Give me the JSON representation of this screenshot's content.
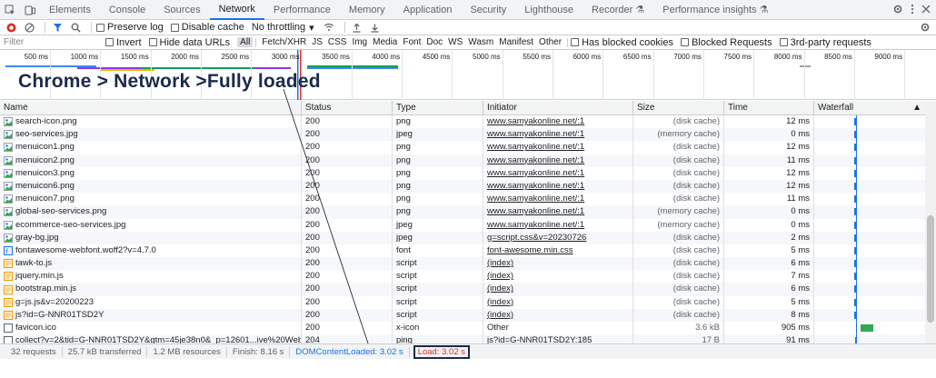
{
  "tabs": [
    {
      "label": "Elements",
      "active": false
    },
    {
      "label": "Console",
      "active": false
    },
    {
      "label": "Sources",
      "active": false
    },
    {
      "label": "Network",
      "active": true
    },
    {
      "label": "Performance",
      "active": false
    },
    {
      "label": "Memory",
      "active": false
    },
    {
      "label": "Application",
      "active": false
    },
    {
      "label": "Security",
      "active": false
    },
    {
      "label": "Lighthouse",
      "active": false
    },
    {
      "label": "Recorder",
      "active": false
    },
    {
      "label": "Performance insights",
      "active": false
    }
  ],
  "toolbar": {
    "preserve_log": "Preserve log",
    "disable_cache": "Disable cache",
    "throttle": "No throttling"
  },
  "filterbar": {
    "placeholder": "Filter",
    "invert": "Invert",
    "hide_data_urls": "Hide data URLs",
    "types": [
      "All",
      "Fetch/XHR",
      "JS",
      "CSS",
      "Img",
      "Media",
      "Font",
      "Doc",
      "WS",
      "Wasm",
      "Manifest",
      "Other"
    ],
    "blocked_cookies": "Has blocked cookies",
    "blocked_requests": "Blocked Requests",
    "third_party": "3rd-party requests"
  },
  "overview": {
    "ticks": [
      "500 ms",
      "1000 ms",
      "1500 ms",
      "2000 ms",
      "2500 ms",
      "3000 ms",
      "3500 ms",
      "4000 ms",
      "4500 ms",
      "5000 ms",
      "5500 ms",
      "6000 ms",
      "6500 ms",
      "7000 ms",
      "7500 ms",
      "8000 ms",
      "8500 ms",
      "9000 ms",
      "95"
    ]
  },
  "callout": "Chrome > Network >Fully loaded",
  "columns": {
    "name": "Name",
    "status": "Status",
    "type": "Type",
    "initiator": "Initiator",
    "size": "Size",
    "time": "Time",
    "waterfall": "Waterfall"
  },
  "rows": [
    {
      "name": "search-icon.png",
      "status": "200",
      "type": "png",
      "initiator": "www.samyakonline.net/:1",
      "init_link": true,
      "size": "(disk cache)",
      "time": "12 ms",
      "icon": "image-icon",
      "wf": 0.36
    },
    {
      "name": "seo-services.jpg",
      "status": "200",
      "type": "jpeg",
      "initiator": "www.samyakonline.net/:1",
      "init_link": true,
      "size": "(memory cache)",
      "time": "0 ms",
      "icon": "image-icon",
      "wf": 0.36
    },
    {
      "name": "menuicon1.png",
      "status": "200",
      "type": "png",
      "initiator": "www.samyakonline.net/:1",
      "init_link": true,
      "size": "(disk cache)",
      "time": "12 ms",
      "icon": "image-icon",
      "wf": 0.36
    },
    {
      "name": "menuicon2.png",
      "status": "200",
      "type": "png",
      "initiator": "www.samyakonline.net/:1",
      "init_link": true,
      "size": "(disk cache)",
      "time": "11 ms",
      "icon": "image-icon",
      "wf": 0.36
    },
    {
      "name": "menuicon3.png",
      "status": "200",
      "type": "png",
      "initiator": "www.samyakonline.net/:1",
      "init_link": true,
      "size": "(disk cache)",
      "time": "12 ms",
      "icon": "image-icon",
      "wf": 0.36
    },
    {
      "name": "menuicon6.png",
      "status": "200",
      "type": "png",
      "initiator": "www.samyakonline.net/:1",
      "init_link": true,
      "size": "(disk cache)",
      "time": "12 ms",
      "icon": "image-icon",
      "wf": 0.36
    },
    {
      "name": "menuicon7.png",
      "status": "200",
      "type": "png",
      "initiator": "www.samyakonline.net/:1",
      "init_link": true,
      "size": "(disk cache)",
      "time": "11 ms",
      "icon": "image-icon",
      "wf": 0.36
    },
    {
      "name": "global-seo-services.png",
      "status": "200",
      "type": "png",
      "initiator": "www.samyakonline.net/:1",
      "init_link": true,
      "size": "(memory cache)",
      "time": "0 ms",
      "icon": "image-icon",
      "wf": 0.36
    },
    {
      "name": "ecommerce-seo-services.jpg",
      "status": "200",
      "type": "jpeg",
      "initiator": "www.samyakonline.net/:1",
      "init_link": true,
      "size": "(memory cache)",
      "time": "0 ms",
      "icon": "image-icon",
      "wf": 0.36
    },
    {
      "name": "gray-bg.jpg",
      "status": "200",
      "type": "jpeg",
      "initiator": "g=script.css&v=20230726",
      "init_link": true,
      "size": "(disk cache)",
      "time": "2 ms",
      "icon": "image-icon",
      "wf": 0.36
    },
    {
      "name": "fontawesome-webfont.woff2?v=4.7.0",
      "status": "200",
      "type": "font",
      "initiator": "font-awesome.min.css",
      "init_link": true,
      "size": "(disk cache)",
      "time": "5 ms",
      "icon": "font-icon",
      "wf": 0.36
    },
    {
      "name": "tawk-to.js",
      "status": "200",
      "type": "script",
      "initiator": "(index)",
      "init_link": true,
      "size": "(disk cache)",
      "time": "6 ms",
      "icon": "script-icon",
      "wf": 0.36
    },
    {
      "name": "jquery.min.js",
      "status": "200",
      "type": "script",
      "initiator": "(index)",
      "init_link": true,
      "size": "(disk cache)",
      "time": "7 ms",
      "icon": "script-icon",
      "wf": 0.36
    },
    {
      "name": "bootstrap.min.js",
      "status": "200",
      "type": "script",
      "initiator": "(index)",
      "init_link": true,
      "size": "(disk cache)",
      "time": "6 ms",
      "icon": "script-icon",
      "wf": 0.36
    },
    {
      "name": "g=js.js&v=20200223",
      "status": "200",
      "type": "script",
      "initiator": "(index)",
      "init_link": true,
      "size": "(disk cache)",
      "time": "5 ms",
      "icon": "script-icon",
      "wf": 0.36
    },
    {
      "name": "js?id=G-NNR01TSD2Y",
      "status": "200",
      "type": "script",
      "initiator": "(index)",
      "init_link": true,
      "size": "(disk cache)",
      "time": "8 ms",
      "icon": "script-icon",
      "wf": 0.36
    },
    {
      "name": "favicon.ico",
      "status": "200",
      "type": "x-icon",
      "initiator": "Other",
      "init_link": false,
      "size": "3.6 kB",
      "time": "905 ms",
      "icon": "document-icon",
      "wf": 0.42
    },
    {
      "name": "collect?v=2&tid=G-NNR01TSD2Y&gtm=45je38n0&_p=12601...ive%20Website%20De...",
      "status": "204",
      "type": "ping",
      "initiator": "js?id=G-NNR01TSD2Y:185",
      "init_link": true,
      "size": "17 B",
      "time": "91 ms",
      "icon": "document-icon",
      "wf": 0.37
    }
  ],
  "status": {
    "requests": "32 requests",
    "transferred": "25.7 kB transferred",
    "resources": "1.2 MB resources",
    "finish": "Finish: 8.16 s",
    "dcl": "DOMContentLoaded: 3.02 s",
    "load": "Load: 3.02 s"
  },
  "colors": {
    "accent": "#1a73e8",
    "load": "#d93025",
    "callout": "#1c2b4a"
  }
}
